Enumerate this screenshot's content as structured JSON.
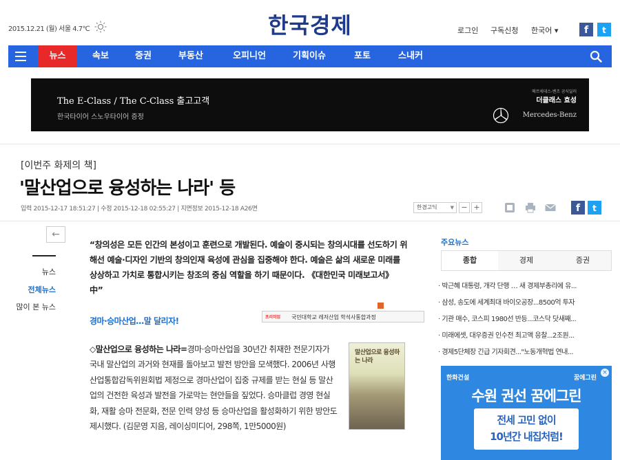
{
  "header": {
    "date": "2015.12.21 (월) 서울 4.7℃",
    "logo": "한국경제",
    "login": "로그인",
    "subscribe": "구독신청",
    "language": "한국어 ▾",
    "facebook_glyph": "f",
    "twitter_glyph": "t"
  },
  "nav": {
    "tabs": [
      {
        "label": "뉴스"
      },
      {
        "label": "속보"
      },
      {
        "label": "증권"
      },
      {
        "label": "부동산"
      },
      {
        "label": "오피니언"
      },
      {
        "label": "기획이슈"
      },
      {
        "label": "포토"
      },
      {
        "label": "스내커"
      }
    ]
  },
  "banner": {
    "line1": "The E-Class / The C-Class 출고고객",
    "line2": "한국타이어 스노우타이어 증정",
    "dealer_small": "메르세데스-벤츠 공식딜러",
    "dealer": "더클래스 효성",
    "brand": "Mercedes-Benz"
  },
  "article": {
    "kicker": "[이번주 화제의 책]",
    "headline": "'말산업으로 융성하는 나라' 등",
    "meta": "입력 2015-12-17 18:51:27 | 수정 2015-12-18 02:55:27 | 지면정보 2015-12-18 A26면",
    "font_select": "한경고딕",
    "font_minus": "−",
    "font_plus": "+",
    "back_glyph": "←",
    "quote": "“창의성은 모든 인간의 본성이고 훈련으로 개발된다. 예술이 중시되는 창의시대를 선도하기 위해선 예술·디자인 기반의 창의인재 육성에 관심을 집중해야 한다. 예술은 삶의 새로운 미래를 상상하고 가치로 통합시키는 창조의 중심 역할을 하기 때문이다. 《대한민국 미래보고서》 中”",
    "sublink": "경마·승마산업…말 달리자!",
    "body_bold": "◇말산업으로 융성하는 나라=",
    "body": "경마·승마산업을 30년간 취재한 전문기자가 국내 말산업의 과거와 현재를 돌아보고 발전 방안을 모색했다. 2006년 사행산업통합감독위원회법 제정으로 경마산업이 집중 규제를 받는 현실 등 말산업의 건전한 육성과 발전을 가로막는 현안들을 짚었다. 승마클럽 경영 현실화, 재활 승마 전문화, 전문 인력 양성 등 승마산업을 활성화하기 위한 방안도 제시했다. (김문영 지음, 레이싱미디어, 298쪽, 1만5000원)",
    "book_title": "말산업으로 융성하는 나라"
  },
  "mini_ad": {
    "tag": "프리미엄",
    "text": "국민대학교 레저산업 학석사통합과정"
  },
  "left_nav": {
    "items": [
      "뉴스",
      "전체뉴스",
      "많이 본 뉴스"
    ]
  },
  "right": {
    "title": "주요뉴스",
    "tabs": [
      "종합",
      "경제",
      "증권"
    ],
    "news": [
      "· 박근혜 대통령, 개각 단행 … 새 경제부총리에 유...",
      "· 삼성, 송도에 세계최대 바이오공장...8500억 투자",
      "· 기관 매수, 코스피 1980선 반등...코스닥 닷새째...",
      "· 미래에셋, 대우증권 인수전 최고액 응찰...2조원...",
      "· 경제5단체장 긴급 기자회견...\"노동개혁법 연내..."
    ]
  },
  "side_ad": {
    "brand": "한화건설",
    "brand2": "꿈에그린",
    "headline": "수원 권선 꿈에그린",
    "line1": "전세 고민 없이",
    "line2": "10년간 내집처럼!",
    "close": "×"
  }
}
